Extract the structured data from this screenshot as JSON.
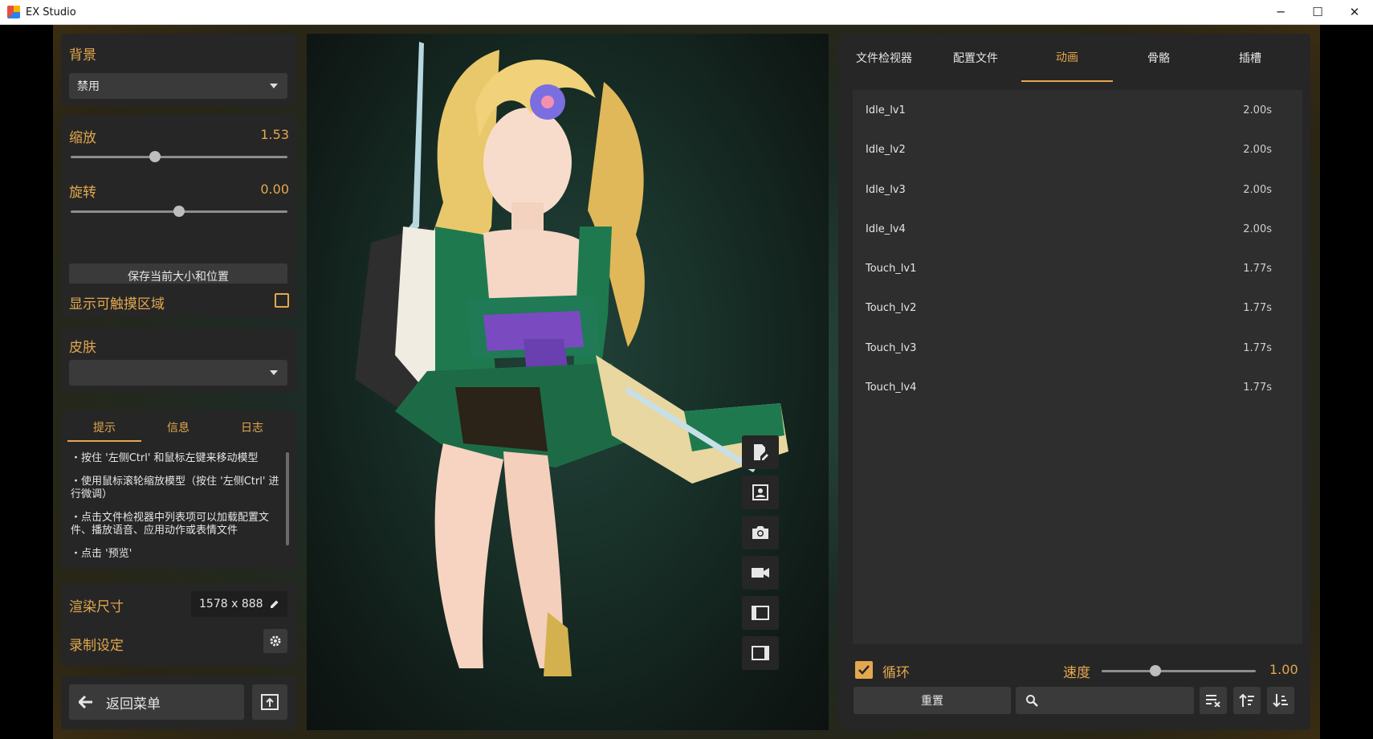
{
  "window": {
    "title": "EX Studio",
    "minimize": "─",
    "maximize": "☐",
    "close": "✕"
  },
  "left": {
    "background": {
      "label": "背景",
      "value": "禁用"
    },
    "scale": {
      "label": "缩放",
      "value": "1.53",
      "level": 0.39
    },
    "rotate": {
      "label": "旋转",
      "value": "0.00",
      "level": 0.5
    },
    "save_button": "保存当前大小和位置",
    "touch_area": {
      "label": "显示可触摸区域",
      "checked": false
    },
    "skin": {
      "label": "皮肤",
      "value": ""
    },
    "info_tabs": [
      "提示",
      "信息",
      "日志"
    ],
    "hints": [
      "・按住 '左侧Ctrl' 和鼠标左键来移动模型",
      "・使用鼠标滚轮缩放模型（按住 '左侧Ctrl' 进行微调）",
      "・点击文件检视器中列表项可以加载配置文件、播放语音、应用动作或表情文件",
      "・点击 '预览'"
    ],
    "render_size": {
      "label": "渲染尺寸",
      "value": "1578 x 888"
    },
    "record_settings": {
      "label": "录制设定"
    },
    "back_button": "返回菜单"
  },
  "viewport": {
    "tools": [
      "edit-doc-icon",
      "portrait-icon",
      "camera-icon",
      "video-camera-icon",
      "panel-left-icon",
      "panel-right-icon"
    ]
  },
  "right": {
    "tabs": [
      "文件检视器",
      "配置文件",
      "动画",
      "骨骼",
      "插槽"
    ],
    "active_tab": "动画",
    "animations": [
      {
        "name": "Idle_lv1",
        "duration": "2.00s"
      },
      {
        "name": "Idle_lv2",
        "duration": "2.00s"
      },
      {
        "name": "Idle_lv3",
        "duration": "2.00s"
      },
      {
        "name": "Idle_lv4",
        "duration": "2.00s"
      },
      {
        "name": "Touch_lv1",
        "duration": "1.77s"
      },
      {
        "name": "Touch_lv2",
        "duration": "1.77s"
      },
      {
        "name": "Touch_lv3",
        "duration": "1.77s"
      },
      {
        "name": "Touch_lv4",
        "duration": "1.77s"
      }
    ],
    "loop": {
      "label": "循环",
      "checked": true
    },
    "speed": {
      "label": "速度",
      "value": "1.00",
      "level": 0.35
    },
    "reset_button": "重置"
  },
  "colors": {
    "accent": "#e3a84e",
    "panel": "#262626",
    "control": "#3a3a3a"
  }
}
